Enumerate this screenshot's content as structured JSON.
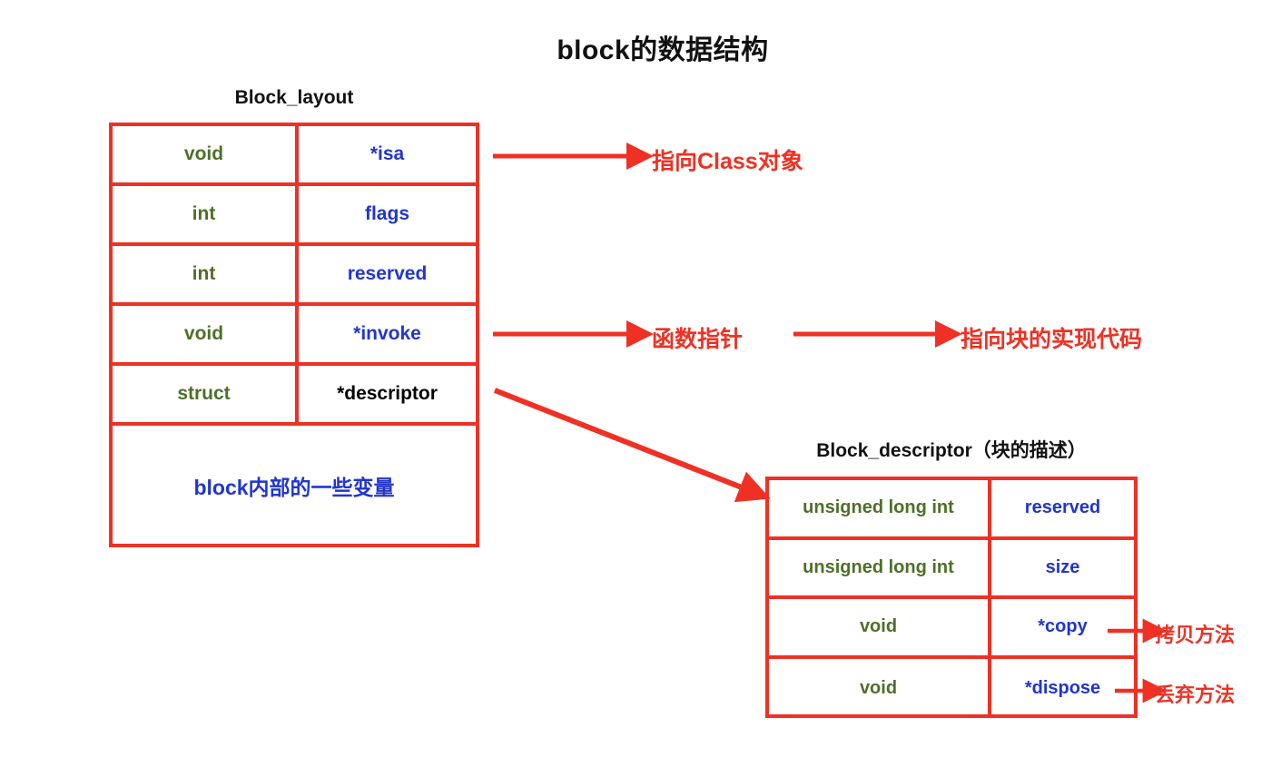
{
  "title": "block的数据结构",
  "structs": [
    {
      "caption": "Block_layout",
      "rows": [
        {
          "type": "void",
          "name": "*isa",
          "name_color": "blue"
        },
        {
          "type": "int",
          "name": "flags",
          "name_color": "blue"
        },
        {
          "type": "int",
          "name": "reserved",
          "name_color": "blue"
        },
        {
          "type": "void",
          "name": "*invoke",
          "name_color": "blue"
        },
        {
          "type": "struct",
          "name": "*descriptor",
          "name_color": "black"
        }
      ],
      "footer_row": "block内部的一些变量"
    },
    {
      "caption": "Block_descriptor（块的描述）",
      "rows": [
        {
          "type": "unsigned long int",
          "name": "reserved",
          "name_color": "blue"
        },
        {
          "type": "unsigned long int",
          "name": "size",
          "name_color": "blue"
        },
        {
          "type": "void",
          "name": "*copy",
          "name_color": "blue"
        },
        {
          "type": "void",
          "name": "*dispose",
          "name_color": "blue"
        }
      ]
    }
  ],
  "annotations": {
    "isa_target": "指向Class对象",
    "invoke_target": "函数指针",
    "invoke_target2": "指向块的实现代码",
    "copy_target": "拷贝方法",
    "dispose_target": "丢弃方法"
  },
  "colors": {
    "red": "#ee3124",
    "blue": "#2135cf",
    "green": "#4e7028",
    "black": "#000000",
    "background": "#ffffff"
  }
}
